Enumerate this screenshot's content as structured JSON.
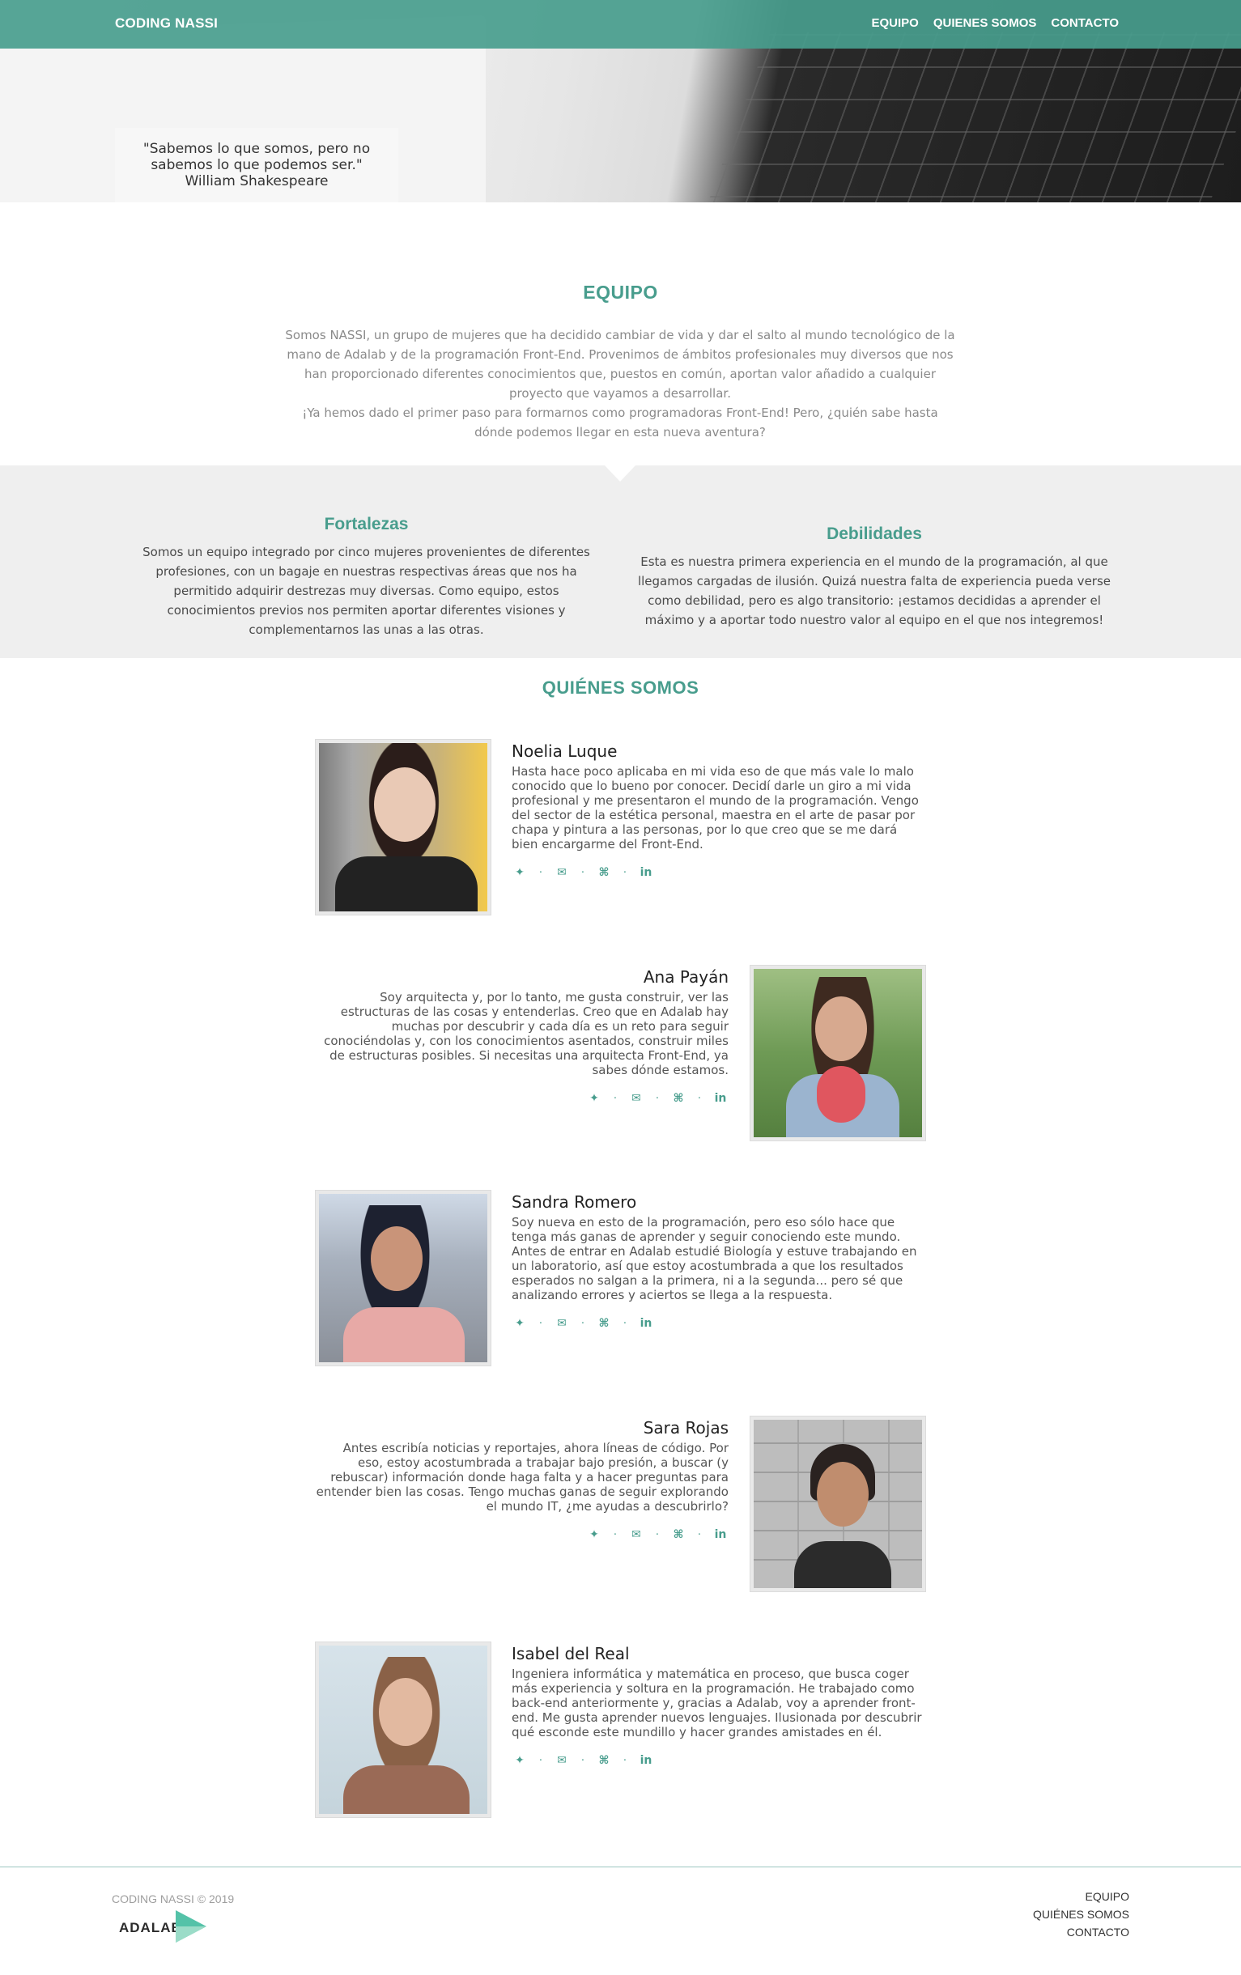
{
  "header": {
    "brand": "CODING NASSI",
    "nav": [
      "EQUIPO",
      "QUIENES SOMOS",
      "CONTACTO"
    ],
    "quote_line1": "\"Sabemos lo que somos, pero no",
    "quote_line2": "sabemos lo que podemos ser.\"",
    "quote_author": "William Shakespeare"
  },
  "equipo": {
    "title": "EQUIPO",
    "text1": "Somos NASSI, un grupo de mujeres que ha decidido cambiar de vida y dar el salto al mundo tecnológico de la mano de Adalab y de la programación Front-End. Provenimos de ámbitos profesionales muy diversos que nos han proporcionado diferentes conocimientos que, puestos en común, aportan valor añadido a cualquier proyecto que vayamos a desarrollar.",
    "text2": "¡Ya hemos dado el primer paso para formarnos como programadoras Front-End! Pero, ¿quién sabe hasta dónde podemos llegar en esta nueva aventura?"
  },
  "fortalezas": {
    "title": "Fortalezas",
    "text": "Somos un equipo integrado por cinco mujeres provenientes de diferentes profesiones, con un bagaje en nuestras respectivas áreas que nos ha permitido adquirir destrezas muy diversas. Como equipo, estos conocimientos previos nos permiten aportar diferentes visiones y complementarnos las unas a las otras."
  },
  "debilidades": {
    "title": "Debilidades",
    "text": "Esta es nuestra primera experiencia en el mundo de la programación, al que llegamos cargadas de ilusión. Quizá nuestra falta de experiencia pueda verse como debilidad, pero es algo transitorio: ¡estamos decididas a aprender el máximo y a aportar todo nuestro valor al equipo en el que nos integremos!"
  },
  "quienes_somos": {
    "title": "QUIÉNES SOMOS",
    "members": [
      {
        "name": "Noelia Luque",
        "bio": "Hasta hace poco aplicaba en mi vida eso de que más vale lo malo conocido que lo bueno por conocer. Decidí darle un giro a mi vida profesional y me presentaron el mundo de la programación. Vengo del sector de la estética personal, maestra en el arte de pasar por chapa y pintura a las personas, por lo que creo que se me dará bien encargarme del Front-End."
      },
      {
        "name": "Ana Payán",
        "bio": "Soy arquitecta y, por lo tanto, me gusta construir, ver las estructuras de las cosas y entenderlas. Creo que en Adalab hay muchas por descubrir y cada día es un reto para seguir conociéndolas y, con los conocimientos asentados, construir miles de estructuras posibles. Si necesitas una arquitecta Front-End, ya sabes dónde estamos."
      },
      {
        "name": "Sandra Romero",
        "bio": "Soy nueva en esto de la programación, pero eso sólo hace que tenga más ganas de aprender y seguir conociendo este mundo. Antes de entrar en Adalab estudié Biología y estuve trabajando en un laboratorio, así que estoy acostumbrada a que los resultados esperados no salgan a la primera, ni a la segunda... pero sé que analizando errores y aciertos se llega a la respuesta."
      },
      {
        "name": "Sara Rojas",
        "bio": "Antes escribía noticias y reportajes, ahora líneas de código. Por eso, estoy acostumbrada a trabajar bajo presión, a buscar (y rebuscar) información donde haga falta y a hacer preguntas para entender bien las cosas. Tengo muchas ganas de seguir explorando el mundo IT, ¿me ayudas a descubrirlo?"
      },
      {
        "name": "Isabel del Real",
        "bio": "Ingeniera informática y matemática en proceso, que busca coger más experiencia y soltura en la programación. He trabajado como back-end anteriormente y, gracias a Adalab, voy a aprender front-end. Me gusta aprender nuevos lenguajes. Ilusionada por descubrir qué esconde este mundillo y hacer grandes amistades en él."
      }
    ],
    "social_icons": {
      "twitter": "🐦",
      "mail": "✉",
      "github": "⌘",
      "linkedin": "in",
      "separator": "·"
    }
  },
  "footer": {
    "copyright": "CODING NASSI © 2019",
    "logo_text": "ADALAB",
    "links": [
      "EQUIPO",
      "QUIÉNES SOMOS",
      "CONTACTO"
    ]
  },
  "colors": {
    "accent": "#489d8d",
    "band": "#efefef"
  }
}
